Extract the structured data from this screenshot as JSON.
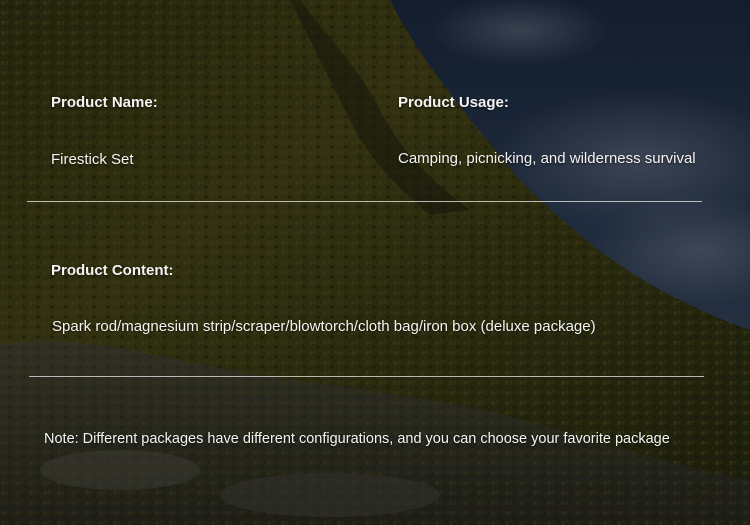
{
  "product_name": {
    "label": "Product Name:",
    "value": "Firestick Set"
  },
  "product_usage": {
    "label": "Product Usage:",
    "value": "Camping, picnicking, and wilderness survival"
  },
  "product_content": {
    "label": "Product Content:",
    "value": "Spark rod/magnesium strip/scraper/blowtorch/cloth bag/iron box (deluxe package)"
  },
  "note": {
    "text": "Note: Different packages have different configurations, and you can choose your favorite package"
  },
  "colors": {
    "text": "#f4f4f2",
    "divider": "#e8e8e4",
    "sky": "#1c2a3c",
    "mountain": "#3a3a14"
  }
}
